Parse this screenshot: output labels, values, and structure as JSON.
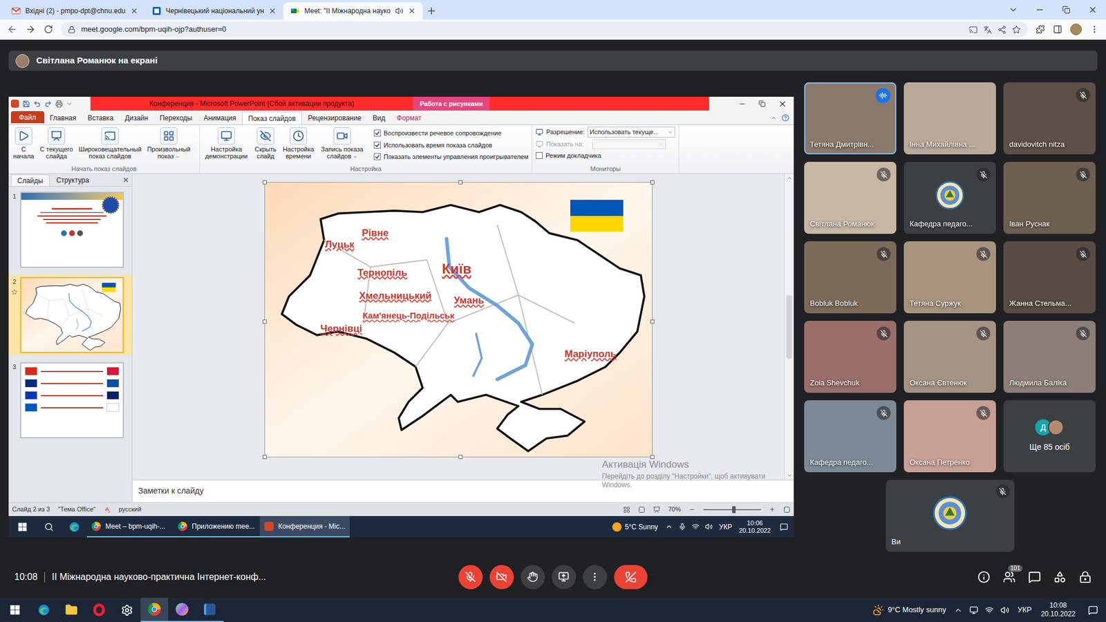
{
  "browser": {
    "tabs": [
      {
        "label": "Вхідні (2) - pmpo-dpt@chnu.edu",
        "selected": false,
        "kind": "gmail",
        "audio": false
      },
      {
        "label": "Чернівецький національний ун",
        "selected": false,
        "kind": "site",
        "audio": false
      },
      {
        "label": "Meet: \"ІІ Міжнародна науко",
        "selected": true,
        "kind": "meet",
        "audio": true
      }
    ],
    "address": "meet.google.com/bpm-uqih-ojp?authuser=0"
  },
  "meet": {
    "presenter_banner": "Світлана Романюк на екрані",
    "time": "10:08",
    "meeting_title": "ІІ Міжнародна науково-практична Інтернет-конф...",
    "participants_count": "101",
    "mic_muted": true,
    "camera_off": true,
    "tiles": [
      {
        "name": "Тетяна Дмитрівн...",
        "muted": false,
        "speaking": true,
        "kind": "video"
      },
      {
        "name": "Інна Михайлівна ...",
        "muted": false,
        "speaking": false,
        "kind": "video"
      },
      {
        "name": "davidovitch nitza",
        "muted": true,
        "speaking": false,
        "kind": "video"
      },
      {
        "name": "Світлана Романюк",
        "muted": true,
        "speaking": false,
        "kind": "video"
      },
      {
        "name": "Кафедра педаго...",
        "muted": true,
        "speaking": false,
        "kind": "avatar"
      },
      {
        "name": "Іван Руснак",
        "muted": true,
        "speaking": false,
        "kind": "video"
      },
      {
        "name": "Bobluk Bobluk",
        "muted": true,
        "speaking": false,
        "kind": "video"
      },
      {
        "name": "Тетяна Суржук",
        "muted": true,
        "speaking": false,
        "kind": "video"
      },
      {
        "name": "Жанна Стельма...",
        "muted": true,
        "speaking": false,
        "kind": "video"
      },
      {
        "name": "Zoia Shevchuk",
        "muted": true,
        "speaking": false,
        "kind": "video"
      },
      {
        "name": "Оксана Євтенюк",
        "muted": true,
        "speaking": false,
        "kind": "video"
      },
      {
        "name": "Людмила Баліка",
        "muted": true,
        "speaking": false,
        "kind": "video"
      },
      {
        "name": "Кафедра педаго...",
        "muted": true,
        "speaking": false,
        "kind": "video"
      },
      {
        "name": "Оксана Петренко",
        "muted": true,
        "speaking": false,
        "kind": "video"
      },
      {
        "name": "Ще 85 осіб",
        "muted": false,
        "speaking": false,
        "kind": "more",
        "initial": "Д"
      }
    ],
    "self_tile": {
      "name": "Ви",
      "muted": true
    }
  },
  "powerpoint": {
    "title": "Конференция - Microsoft PowerPoint (Сбой активации продукта)",
    "context_tab": "Работа с рисунками",
    "tabs": [
      {
        "label": "Файл",
        "selected": false,
        "kind": "file"
      },
      {
        "label": "Главная",
        "selected": false,
        "kind": "tab"
      },
      {
        "label": "Вставка",
        "selected": false,
        "kind": "tab"
      },
      {
        "label": "Дизайн",
        "selected": false,
        "kind": "tab"
      },
      {
        "label": "Переходы",
        "selected": false,
        "kind": "tab"
      },
      {
        "label": "Анимация",
        "selected": false,
        "kind": "tab"
      },
      {
        "label": "Показ слайдов",
        "selected": true,
        "kind": "tab"
      },
      {
        "label": "Рецензирование",
        "selected": false,
        "kind": "tab"
      },
      {
        "label": "Вид",
        "selected": false,
        "kind": "tab"
      },
      {
        "label": "Формат",
        "selected": false,
        "kind": "context"
      }
    ],
    "ribbon": {
      "start_group": {
        "label": "Начать показ слайдов",
        "buttons": [
          {
            "label": "С начала",
            "dropdown": false
          },
          {
            "label": "С текущего слайда",
            "dropdown": false
          },
          {
            "label": "Широковещательный показ слайдов",
            "dropdown": false
          },
          {
            "label": "Произвольный показ",
            "dropdown": true
          }
        ]
      },
      "setup_group": {
        "label": "Настройка",
        "buttons": [
          {
            "label": "Настройка демонстрации",
            "dropdown": false
          },
          {
            "label": "Скрыть слайд",
            "dropdown": false
          },
          {
            "label": "Настройка времени",
            "dropdown": false
          },
          {
            "label": "Запись показа слайдов",
            "dropdown": true
          }
        ],
        "checkboxes": [
          {
            "label": "Воспроизвести речевое сопровождение",
            "checked": true
          },
          {
            "label": "Использовать время показа слайдов",
            "checked": true
          },
          {
            "label": "Показать элементы управления проигрывателем",
            "checked": true
          }
        ]
      },
      "monitors_group": {
        "label": "Мониторы",
        "resolution_label": "Разрешение:",
        "resolution_value": "Использовать текуще...",
        "show_on_label": "Показать на:",
        "show_on_disabled": true,
        "presenter_view": {
          "label": "Режим докладчика",
          "checked": false
        }
      }
    },
    "pane_tabs": [
      {
        "label": "Слайды",
        "selected": true
      },
      {
        "label": "Структура",
        "selected": false
      }
    ],
    "slides": [
      {
        "number": "1",
        "selected": false,
        "kind": "welcome",
        "animated": false
      },
      {
        "number": "2",
        "selected": true,
        "kind": "map",
        "animated": true
      },
      {
        "number": "3",
        "selected": false,
        "kind": "flags",
        "animated": false
      }
    ],
    "slide": {
      "picture_selected": true,
      "cities": [
        {
          "name": "Луцьк",
          "kind": "city"
        },
        {
          "name": "Рівне",
          "kind": "city"
        },
        {
          "name": "Тернопіль",
          "kind": "city"
        },
        {
          "name": "Київ",
          "kind": "capital"
        },
        {
          "name": "Хмельницький",
          "kind": "city"
        },
        {
          "name": "Умань",
          "kind": "city"
        },
        {
          "name": "Кам'янець-Подільськ",
          "kind": "small"
        },
        {
          "name": "Чернівці",
          "kind": "city"
        },
        {
          "name": "Маріуполь",
          "kind": "city"
        }
      ]
    },
    "notes_placeholder": "Заметки к слайду",
    "status": {
      "slide": "Слайд 2 из 3",
      "theme": "\"Тема Office\"",
      "language": "русский",
      "zoom": "70%",
      "zoom_level": 0.5
    },
    "watermark": {
      "title": "Активація Windows",
      "text": "Перейдіть до розділу \"Настройки\", щоб активувати Windows."
    }
  },
  "inner_taskbar": {
    "apps": [
      {
        "label": "Meet – bpm-uqih-...",
        "selected": false
      },
      {
        "label": "Приложению mee...",
        "selected": false
      },
      {
        "label": "Конференция - Mic...",
        "selected": true
      }
    ],
    "weather": "5°C Sunny",
    "language": "УКР",
    "time": "10:06",
    "date": "20.10.2022"
  },
  "taskbar": {
    "weather": "9°C Mostly sunny",
    "language": "УКР",
    "time": "10:08",
    "date": "20.10.2022"
  }
}
